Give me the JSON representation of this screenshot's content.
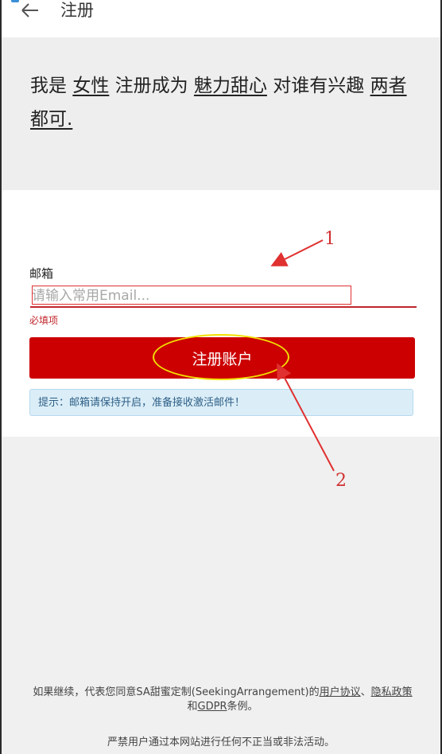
{
  "header": {
    "title": "注册"
  },
  "profile": {
    "i_am": "我是",
    "gender": "女性",
    "register_as": "注册成为",
    "role": "魅力甜心",
    "interested_in": "对谁有兴趣",
    "preference": "两者都可."
  },
  "form": {
    "email_label": "邮箱",
    "email_placeholder": "请输入常用Email...",
    "email_value": "",
    "required_text": "必填项",
    "submit_label": "注册账户",
    "hint_text": "提示：邮箱请保持开启，准备接收激活邮件！"
  },
  "annotations": {
    "label_1": "1",
    "label_2": "2",
    "color": "#d03030",
    "highlight_color": "#f2e000"
  },
  "footer": {
    "prefix": "如果继续，代表您同意SA甜蜜定制(SeekingArrangement)的",
    "user_agreement": "用户协议",
    "sep": "、",
    "privacy_policy": "隐私政策",
    "and": "和",
    "gdpr": "GDPR",
    "suffix": "条例。",
    "warning": "严禁用户通过本网站进行任何不正当或非法活动。"
  },
  "colors": {
    "accent": "#cc0000",
    "hint_bg": "#dbeef8"
  }
}
